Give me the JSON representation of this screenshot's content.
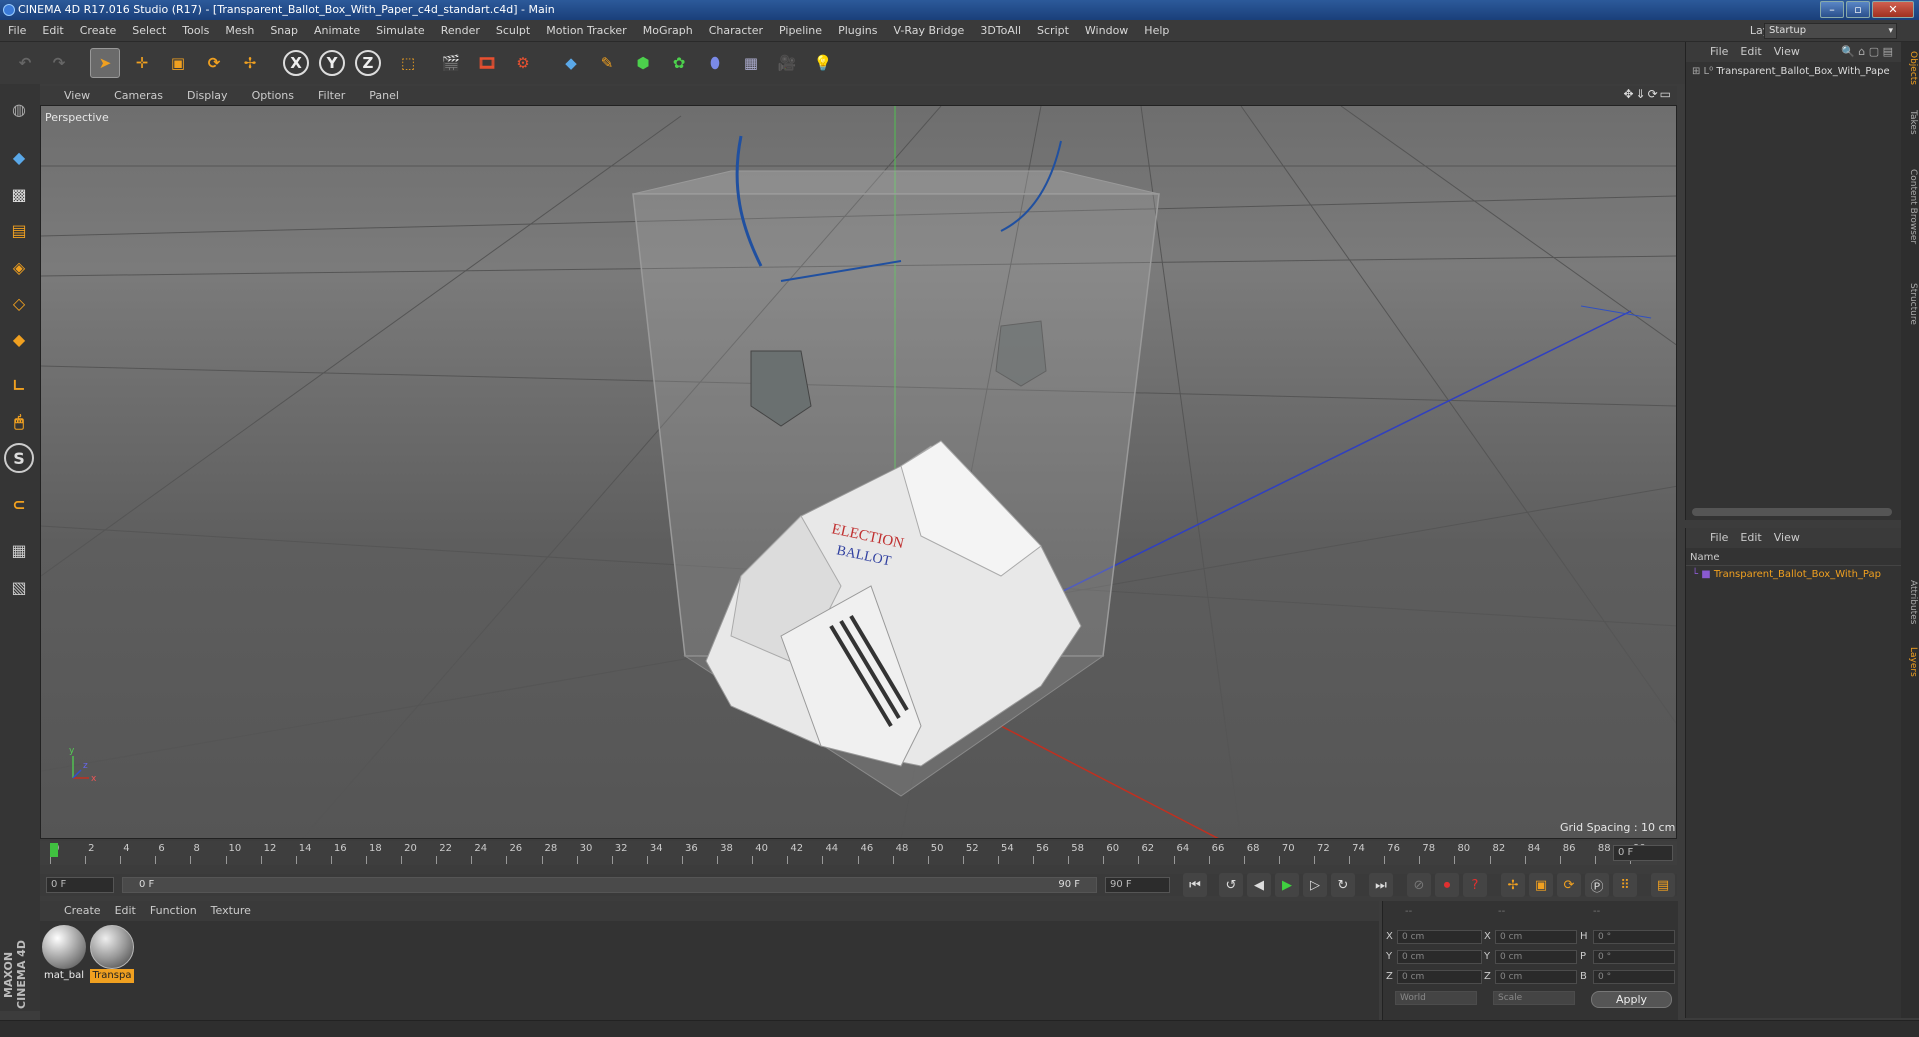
{
  "window": {
    "title": "CINEMA 4D R17.016 Studio (R17) - [Transparent_Ballot_Box_With_Paper_c4d_standart.c4d] - Main",
    "minimize": "–",
    "maximize": "▫",
    "close": "✕"
  },
  "menubar": [
    "File",
    "Edit",
    "Create",
    "Select",
    "Tools",
    "Mesh",
    "Snap",
    "Animate",
    "Simulate",
    "Render",
    "Sculpt",
    "Motion Tracker",
    "MoGraph",
    "Character",
    "Pipeline",
    "Plugins",
    "V-Ray Bridge",
    "3DToAll",
    "Script",
    "Window",
    "Help"
  ],
  "layout": {
    "label": "Layout:",
    "value": "Startup"
  },
  "toolbar": {
    "x_axis": "X",
    "y_axis": "Y",
    "z_axis": "Z"
  },
  "viewport": {
    "menu": [
      "View",
      "Cameras",
      "Display",
      "Options",
      "Filter",
      "Panel"
    ],
    "label": "Perspective",
    "grid_spacing": "Grid Spacing : 10 cm",
    "paper_text_1": "ELECTION",
    "paper_text_2": "BALLOT",
    "nav_icons": "✥⇓⟳▭",
    "axis_x": "x",
    "axis_y": "y",
    "axis_z": "z"
  },
  "timeline": {
    "ticks": [
      "0",
      "2",
      "4",
      "6",
      "8",
      "10",
      "12",
      "14",
      "16",
      "18",
      "20",
      "22",
      "24",
      "26",
      "28",
      "30",
      "32",
      "34",
      "36",
      "38",
      "40",
      "42",
      "44",
      "46",
      "48",
      "50",
      "52",
      "54",
      "56",
      "58",
      "60",
      "62",
      "64",
      "66",
      "68",
      "70",
      "72",
      "74",
      "76",
      "78",
      "80",
      "82",
      "84",
      "86",
      "88",
      "90"
    ],
    "current_frame": "0 F",
    "start": "0 F",
    "range_start": "0 F",
    "range_end": "90 F",
    "end": "90 F"
  },
  "materials": {
    "menu": [
      "Create",
      "Edit",
      "Function",
      "Texture"
    ],
    "items": [
      {
        "name": "mat_bal"
      },
      {
        "name": "Transpa"
      }
    ]
  },
  "coordinates": {
    "header": [
      "--",
      "--",
      "--"
    ],
    "rows": [
      {
        "l1": "X",
        "v1": "0 cm",
        "l2": "X",
        "v2": "0 cm",
        "l3": "H",
        "v3": "0 °"
      },
      {
        "l1": "Y",
        "v1": "0 cm",
        "l2": "Y",
        "v2": "0 cm",
        "l3": "P",
        "v3": "0 °"
      },
      {
        "l1": "Z",
        "v1": "0 cm",
        "l2": "Z",
        "v2": "0 cm",
        "l3": "B",
        "v3": "0 °"
      }
    ],
    "world": "World",
    "scale": "Scale",
    "apply": "Apply"
  },
  "objects": {
    "menu": [
      "File",
      "Edit",
      "View"
    ],
    "item": "Transparent_Ballot_Box_With_Pape"
  },
  "layers": {
    "menu": [
      "File",
      "Edit",
      "View"
    ],
    "name_header": "Name",
    "item": "Transparent_Ballot_Box_With_Pap"
  },
  "side_tabs": [
    "Objects",
    "Takes",
    "Content Browser",
    "Structure",
    "Attributes",
    "Layers"
  ],
  "branding": "MAXON CINEMA 4D",
  "colors": {
    "accent": "#f0a020",
    "selection": "#e8a020",
    "title_bar": "#2c5a9a"
  }
}
